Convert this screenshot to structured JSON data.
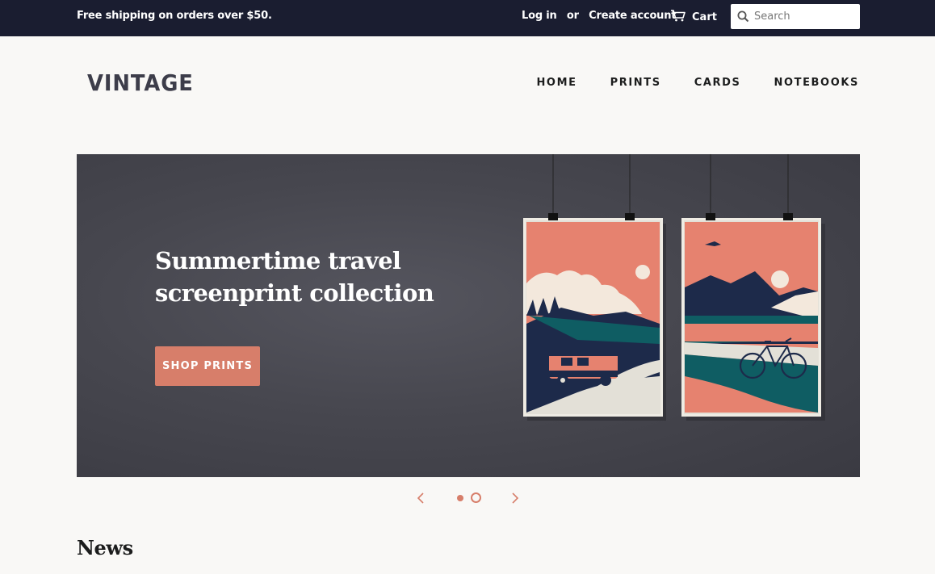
{
  "topbar": {
    "promo": "Free shipping on orders over $50.",
    "login": "Log in",
    "or": "or",
    "create_account": "Create account",
    "cart_label": "Cart",
    "cart_icon": "cart-icon",
    "search_placeholder": "Search",
    "search_icon": "search-icon"
  },
  "header": {
    "logo": "VINTAGE",
    "nav": [
      "HOME",
      "PRINTS",
      "CARDS",
      "NOTEBOOKS"
    ]
  },
  "hero": {
    "headline": "Summertime travel screenprint collection",
    "cta": "SHOP PRINTS"
  },
  "slideshow": {
    "prev_icon": "chevron-left-icon",
    "next_icon": "chevron-right-icon",
    "slides_count": 2,
    "active_slide": 1
  },
  "news_heading": "News",
  "colors": {
    "topbar": "#1a1d30",
    "accent": "#d77e6a",
    "background": "#f9f8f6"
  }
}
